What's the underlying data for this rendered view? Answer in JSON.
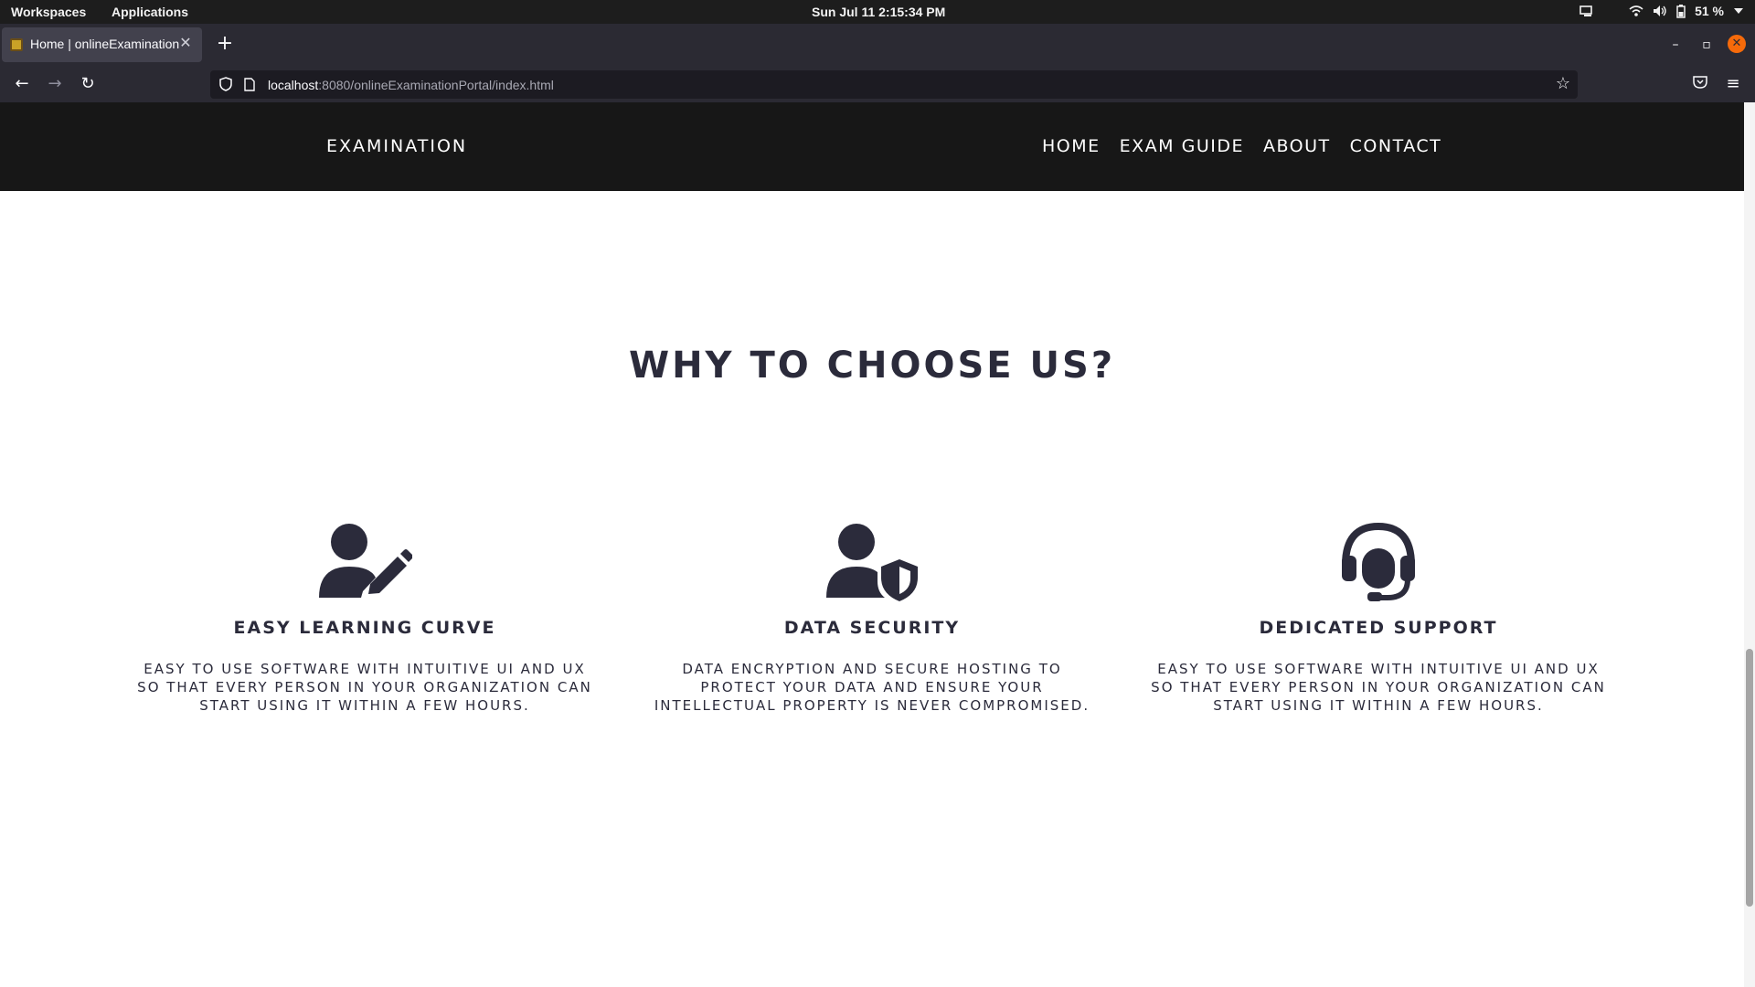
{
  "os_bar": {
    "workspaces": "Workspaces",
    "applications": "Applications",
    "datetime": "Sun Jul 11   2:15:34 PM",
    "battery": "51 %"
  },
  "browser": {
    "tab_title": "Home | onlineExaminationPortal",
    "url_host": "localhost",
    "url_path": ":8080/onlineExaminationPortal/index.html"
  },
  "site": {
    "brand": "EXAMINATION",
    "nav": [
      "HOME",
      "EXAM GUIDE",
      "ABOUT",
      "CONTACT"
    ],
    "section_title": "WHY TO CHOOSE US?",
    "features": [
      {
        "icon": "user-pen-icon",
        "title": "EASY LEARNING CURVE",
        "description": "EASY TO USE SOFTWARE WITH INTUITIVE UI AND UX SO THAT EVERY PERSON IN YOUR ORGANIZATION CAN START USING IT WITHIN A FEW HOURS."
      },
      {
        "icon": "user-shield-icon",
        "title": "DATA SECURITY",
        "description": "DATA ENCRYPTION AND SECURE HOSTING TO PROTECT YOUR DATA AND ENSURE YOUR INTELLECTUAL PROPERTY IS NEVER COMPROMISED."
      },
      {
        "icon": "headset-icon",
        "title": "DEDICATED SUPPORT",
        "description": "EASY TO USE SOFTWARE WITH INTUITIVE UI AND UX SO THAT EVERY PERSON IN YOUR ORGANIZATION CAN START USING IT WITHIN A FEW HOURS."
      }
    ]
  },
  "colors": {
    "header_bg": "#171717",
    "text_dark": "#2b2b3b",
    "browser_chrome": "#2b2a33"
  }
}
